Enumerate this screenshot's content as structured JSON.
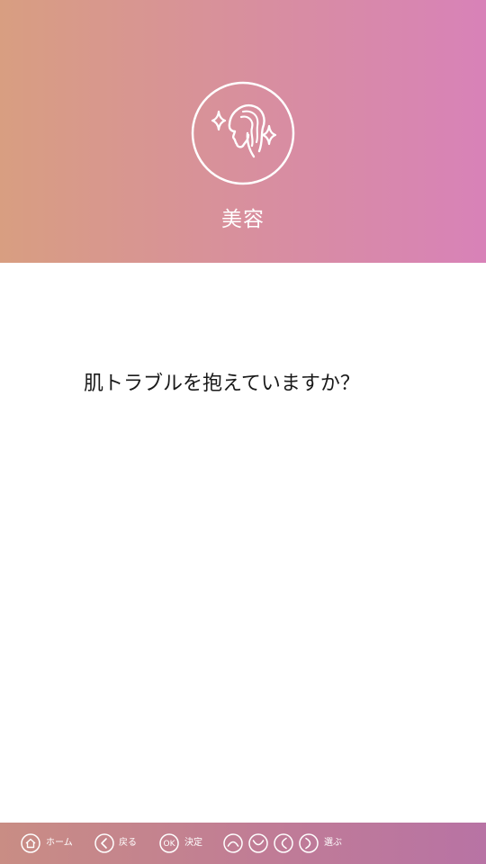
{
  "header": {
    "icon": "beauty-face-sparkle-icon",
    "title": "美容"
  },
  "main": {
    "question": "肌トラブルを抱えていますか？"
  },
  "footer": {
    "home_label": "ホーム",
    "back_label": "戻る",
    "ok_icon_text": "OK",
    "ok_label": "決定",
    "select_label": "選ぶ"
  },
  "colors": {
    "header_gradient": [
      "#d89e81",
      "#d882b8"
    ],
    "footer_gradient": [
      "#c98d84",
      "#b873a4"
    ],
    "text": "#1a1a1a",
    "icon_stroke": "#ffffff"
  }
}
